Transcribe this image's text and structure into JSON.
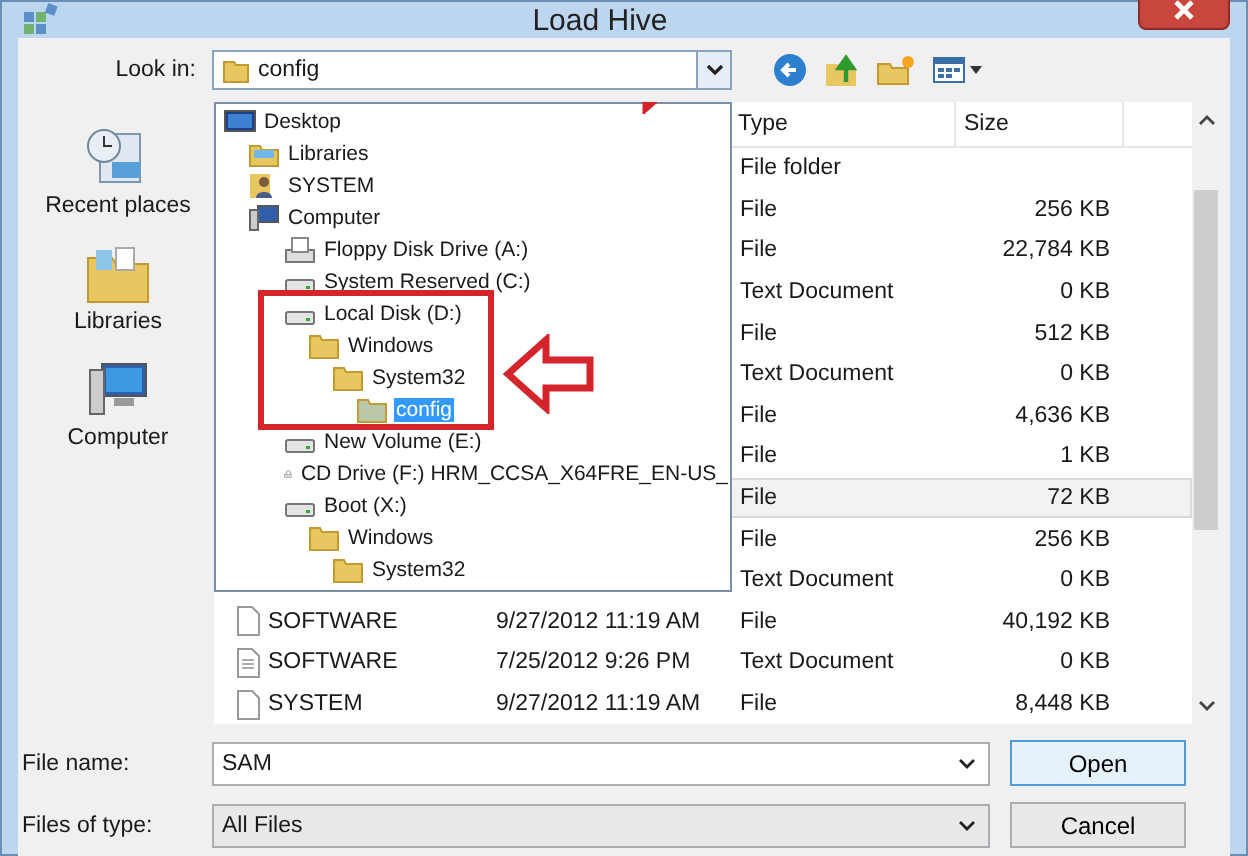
{
  "window": {
    "title": "Load Hive"
  },
  "look_in": {
    "label": "Look in:",
    "value": "config"
  },
  "places": [
    {
      "label": "Recent places",
      "kind": "recent"
    },
    {
      "label": "Libraries",
      "kind": "libraries"
    },
    {
      "label": "Computer",
      "kind": "computer"
    }
  ],
  "location_tree": [
    {
      "label": "Desktop",
      "kind": "desktop",
      "selected": false,
      "children": [
        {
          "label": "Libraries",
          "kind": "library",
          "selected": false
        },
        {
          "label": "SYSTEM",
          "kind": "user",
          "selected": false
        },
        {
          "label": "Computer",
          "kind": "computer",
          "selected": false,
          "children": [
            {
              "label": "Floppy Disk Drive (A:)",
              "kind": "floppy",
              "selected": false
            },
            {
              "label": "System Reserved (C:)",
              "kind": "drive",
              "selected": false
            },
            {
              "label": "Local Disk (D:)",
              "kind": "drive",
              "selected": false,
              "children": [
                {
                  "label": "Windows",
                  "kind": "folder",
                  "selected": false,
                  "children": [
                    {
                      "label": "System32",
                      "kind": "folder",
                      "selected": false,
                      "children": [
                        {
                          "label": "config",
                          "kind": "folder",
                          "selected": true
                        }
                      ]
                    }
                  ]
                }
              ]
            },
            {
              "label": "New Volume (E:)",
              "kind": "drive",
              "selected": false
            },
            {
              "label": "CD Drive (F:) HRM_CCSA_X64FRE_EN-US_",
              "kind": "cd",
              "selected": false
            },
            {
              "label": "Boot (X:)",
              "kind": "drive",
              "selected": false,
              "children": [
                {
                  "label": "Windows",
                  "kind": "folder",
                  "selected": false,
                  "children": [
                    {
                      "label": "System32",
                      "kind": "folder",
                      "selected": false
                    }
                  ]
                }
              ]
            }
          ]
        }
      ]
    }
  ],
  "table": {
    "columns": [
      "Type",
      "Size"
    ],
    "rows": [
      {
        "type": "File folder",
        "selected": false
      },
      {
        "type": "File",
        "size": "256 KB",
        "selected": false
      },
      {
        "type": "File",
        "size": "22,784 KB",
        "selected": false
      },
      {
        "type": "Text Document",
        "size": "0 KB",
        "selected": false
      },
      {
        "type": "File",
        "size": "512 KB",
        "selected": false
      },
      {
        "type": "Text Document",
        "size": "0 KB",
        "selected": false
      },
      {
        "type": "File",
        "size": "4,636 KB",
        "selected": false
      },
      {
        "type": "File",
        "size": "1 KB",
        "selected": false
      },
      {
        "type": "File",
        "size": "72 KB",
        "selected": true
      },
      {
        "type": "File",
        "size": "256 KB",
        "selected": false
      },
      {
        "type": "Text Document",
        "size": "0 KB",
        "selected": false
      },
      {
        "name": "SOFTWARE",
        "date": "9/27/2012 11:19 AM",
        "type": "File",
        "size": "40,192 KB",
        "selected": false
      },
      {
        "name": "SOFTWARE",
        "date": "7/25/2012 9:26 PM",
        "type": "Text Document",
        "size": "0 KB",
        "selected": false
      },
      {
        "name": "SYSTEM",
        "date": "9/27/2012 11:19 AM",
        "type": "File",
        "size": "8,448 KB",
        "selected": false
      }
    ]
  },
  "file_name": {
    "label": "File name:",
    "value": "SAM"
  },
  "file_type": {
    "label": "Files of type:",
    "value": "All Files"
  },
  "buttons": [
    "Open",
    "Cancel"
  ]
}
